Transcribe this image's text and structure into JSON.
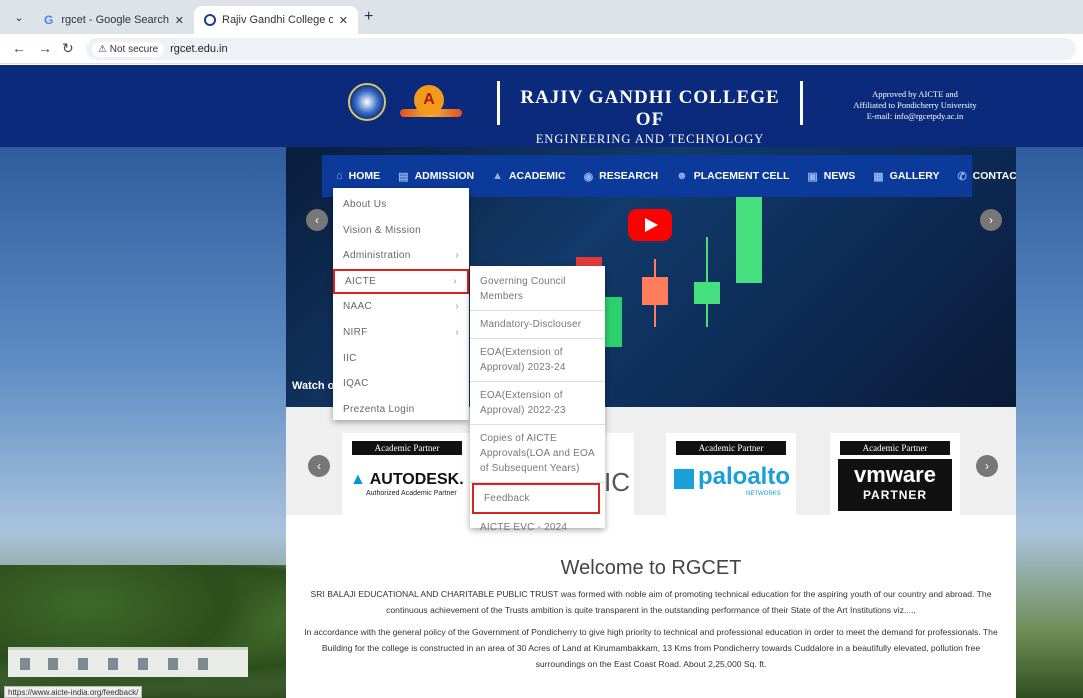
{
  "browser": {
    "tab1_title": "rgcet - Google Search",
    "tab2_title": "Rajiv Gandhi College of Engineer",
    "security": "Not secure",
    "url": "rgcet.edu.in",
    "status_url": "https://www.aicte-india.org/feedback/"
  },
  "header": {
    "college_line1": "RAJIV GANDHI COLLEGE OF",
    "college_line2": "ENGINEERING AND TECHNOLOGY",
    "approval_line1": "Approved by AICTE and",
    "approval_line2": "Affiliated to Pondicherry University",
    "approval_email": "E-mail: info@rgcetpdy.ac.in",
    "naac_letter": "A"
  },
  "nav": {
    "items": [
      {
        "label": "HOME",
        "icon": "home-icon"
      },
      {
        "label": "ADMISSION",
        "icon": "admission-icon"
      },
      {
        "label": "ACADEMIC",
        "icon": "graduation-cap-icon"
      },
      {
        "label": "RESEARCH",
        "icon": "research-icon"
      },
      {
        "label": "PLACEMENT CELL",
        "icon": "users-icon"
      },
      {
        "label": "NEWS",
        "icon": "news-icon"
      },
      {
        "label": "GALLERY",
        "icon": "gallery-icon"
      },
      {
        "label": "CONTACT",
        "icon": "phone-icon"
      }
    ]
  },
  "home_menu": {
    "items": [
      "About Us",
      "Vision & Mission",
      "Administration",
      "AICTE",
      "NAAC",
      "NIRF",
      "IIC",
      "IQAC",
      "Prezenta Login"
    ]
  },
  "aicte_menu": {
    "items": [
      "Governing Council Members",
      "Mandatory-Disclouser",
      "EOA(Extension of Approval) 2023-24",
      "EOA(Extension of Approval) 2022-23",
      "Copies of AICTE Approvals(LOA and EOA of Subsequent Years)",
      "Feedback",
      "AICTE EVC - 2024"
    ]
  },
  "slider": {
    "watch_label": "Watch o"
  },
  "partners": {
    "heading": "Academic Partner",
    "autodesk_name": "AUTODESK.",
    "autodesk_sub": "Authorized Academic Partner",
    "partial_text": "IC",
    "paloalto_name": "paloalto",
    "paloalto_sub": "NETWORKS",
    "vmware_name": "vmware",
    "vmware_sub": "PARTNER"
  },
  "welcome": {
    "title": "Welcome to RGCET",
    "para1": "SRI BALAJI EDUCATIONAL AND CHARITABLE PUBLIC TRUST was formed with noble aim of promoting technical education for the aspiring youth of our country and abroad. The continuous achievement of the Trusts ambition is quite transparent in the outstanding performance of their State of the Art Institutions viz....,",
    "para2": "In accordance with the general policy of the Government of Pondicherry to give high priority to technical and professional education in order to meet the demand for professionals. The Building for the college is constructed in an area of 30 Acres of Land at Kirumambakkam, 13 Kms from Pondicherry towards Cuddalore in a beautifully elevated, pollution free surroundings on the East Coast Road. About 2,25,000 Sq. ft."
  }
}
